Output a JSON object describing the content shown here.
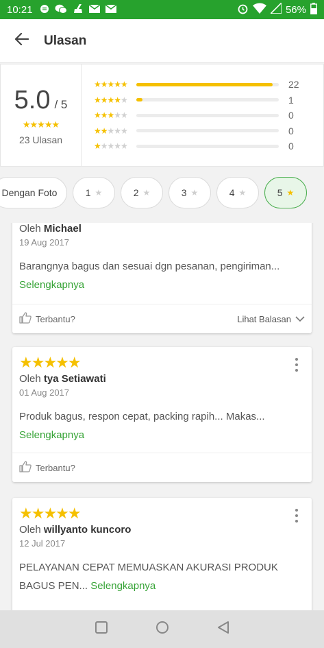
{
  "status_bar": {
    "time": "10:21",
    "battery": "56%",
    "left_icons": [
      "chat-icon",
      "wechat-icon",
      "broom-icon",
      "mail-icon",
      "mail-icon"
    ],
    "right_icons": [
      "alarm-icon",
      "wifi-icon",
      "signal-icon",
      "battery-icon"
    ]
  },
  "app_bar": {
    "title": "Ulasan"
  },
  "summary": {
    "score": "5.0",
    "score_max": "/ 5",
    "total": "23 Ulasan",
    "distribution": [
      {
        "stars": 5,
        "count": "22",
        "fraction": 0.957
      },
      {
        "stars": 4,
        "count": "1",
        "fraction": 0.043
      },
      {
        "stars": 3,
        "count": "0",
        "fraction": 0
      },
      {
        "stars": 2,
        "count": "0",
        "fraction": 0
      },
      {
        "stars": 1,
        "count": "0",
        "fraction": 0
      }
    ]
  },
  "filters": [
    {
      "label": "Dengan Foto",
      "has_star": false,
      "active": false
    },
    {
      "label": "1",
      "has_star": true,
      "active": false
    },
    {
      "label": "2",
      "has_star": true,
      "active": false
    },
    {
      "label": "3",
      "has_star": true,
      "active": false
    },
    {
      "label": "4",
      "has_star": true,
      "active": false
    },
    {
      "label": "5",
      "has_star": true,
      "active": true
    }
  ],
  "reviews": [
    {
      "by_prefix": "Oleh",
      "author": "Michael",
      "date": "19 Aug 2017",
      "text": "Barangnya bagus dan sesuai dgn pesanan, pengiriman...",
      "more": "Selengkapnya",
      "helpful": "Terbantu?",
      "view_reply": "Lihat Balasan"
    },
    {
      "rating": 5,
      "by_prefix": "Oleh",
      "author": "tya Setiawati",
      "date": "01 Aug 2017",
      "text": "Produk bagus, respon cepat, packing rapih... Makas...",
      "more": "Selengkapnya",
      "helpful": "Terbantu?"
    },
    {
      "rating": 5,
      "by_prefix": "Oleh",
      "author": "willyanto kuncoro",
      "date": "12 Jul 2017",
      "text": "PELAYANAN CEPAT MEMUASKAN AKURASI PRODUK BAGUS PEN...",
      "more": "Selengkapnya"
    }
  ],
  "colors": {
    "status_bar": "#27a22d",
    "accent_green": "#36a336",
    "star": "#f5c000"
  }
}
